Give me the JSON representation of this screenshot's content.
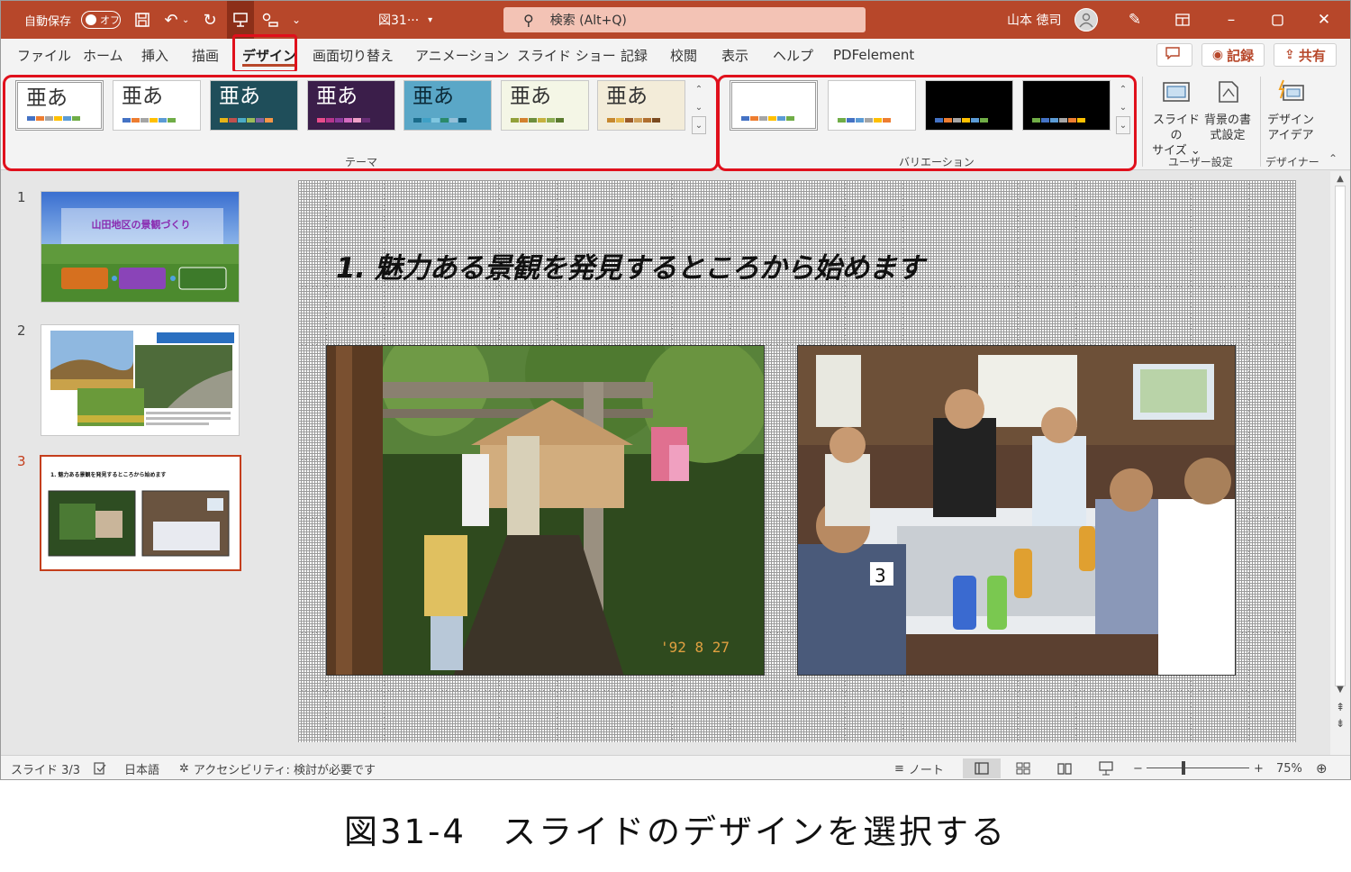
{
  "titlebar": {
    "autosave_label": "自動保存",
    "autosave_state": "オフ",
    "filename": "図31···",
    "filename_caret": "▾",
    "search_placeholder": "検索 (Alt+Q)",
    "username": "山本 徳司",
    "icons": [
      "save-icon",
      "undo-icon",
      "redo-icon",
      "present-icon",
      "touch-mode-icon",
      "customize-icon"
    ],
    "window_icons": [
      "pen-icon",
      "ribbon-display-icon",
      "minimize-icon",
      "maximize-icon",
      "close-icon"
    ]
  },
  "tabs": [
    {
      "label": "ファイル"
    },
    {
      "label": "ホーム"
    },
    {
      "label": "挿入"
    },
    {
      "label": "描画"
    },
    {
      "label": "デザイン",
      "active": true
    },
    {
      "label": "画面切り替え"
    },
    {
      "label": "アニメーション"
    },
    {
      "label": "スライド ショー"
    },
    {
      "label": "記録"
    },
    {
      "label": "校閲"
    },
    {
      "label": "表示"
    },
    {
      "label": "ヘルプ"
    },
    {
      "label": "PDFelement"
    }
  ],
  "ribbon_buttons": {
    "comment": "",
    "record": "記録",
    "share": "共有"
  },
  "themes": {
    "label": "テーマ",
    "glyph": "亜あ",
    "items": [
      {
        "bg": "#ffffff",
        "fg": "#333333",
        "bars": [
          "#4472c4",
          "#ed7d31",
          "#a5a5a5",
          "#ffc000",
          "#5b9bd5",
          "#70ad47"
        ]
      },
      {
        "bg": "#ffffff",
        "fg": "#333333",
        "bars": [
          "#4472c4",
          "#ed7d31",
          "#a5a5a5",
          "#ffc000",
          "#5b9bd5",
          "#70ad47"
        ]
      },
      {
        "bg": "#1f4e5a",
        "fg": "#ffffff",
        "bars": [
          "#e7b416",
          "#c0504d",
          "#4bacc6",
          "#9bbb59",
          "#8064a2",
          "#f79646"
        ]
      },
      {
        "bg": "#3b1e4a",
        "fg": "#ffffff",
        "bars": [
          "#e84c8b",
          "#b5358c",
          "#8b3a9c",
          "#d36bbf",
          "#f0a1c8",
          "#6b2e78"
        ]
      },
      {
        "bg": "#5aa7c7",
        "fg": "#0c2a38",
        "bars": [
          "#1a6b8a",
          "#3ea0c6",
          "#7fc6e0",
          "#2a8a6a",
          "#94c0d8",
          "#0e4f6a"
        ]
      },
      {
        "bg": "#f4f6e6",
        "fg": "#333333",
        "bars": [
          "#92a13a",
          "#d3822f",
          "#6d8f3c",
          "#c6b23f",
          "#8bad52",
          "#5a7a2e"
        ]
      },
      {
        "bg": "#f3ecd9",
        "fg": "#333333",
        "bars": [
          "#c7882f",
          "#e6b54a",
          "#9a5a2a",
          "#d0a05a",
          "#b06f2f",
          "#7a4a20"
        ]
      }
    ]
  },
  "variations": {
    "label": "バリエーション",
    "items": [
      {
        "bg": "#ffffff",
        "bars": [
          "#4472c4",
          "#ed7d31",
          "#a5a5a5",
          "#ffc000",
          "#5b9bd5",
          "#70ad47"
        ]
      },
      {
        "bg": "#ffffff",
        "bars": [
          "#70ad47",
          "#4472c4",
          "#5b9bd5",
          "#a5a5a5",
          "#ffc000",
          "#ed7d31"
        ]
      },
      {
        "bg": "#000000",
        "bars": [
          "#4472c4",
          "#ed7d31",
          "#a5a5a5",
          "#ffc000",
          "#5b9bd5",
          "#70ad47"
        ]
      },
      {
        "bg": "#000000",
        "bars": [
          "#70ad47",
          "#4472c4",
          "#5b9bd5",
          "#a5a5a5",
          "#ed7d31",
          "#ffc000"
        ]
      }
    ]
  },
  "customize_group": {
    "label": "ユーザー設定",
    "slide_size_line1": "スライドの",
    "slide_size_line2": "サイズ ⌄",
    "bg_format_line1": "背景の書",
    "bg_format_line2": "式設定"
  },
  "designer_group": {
    "label": "デザイナー",
    "line1": "デザイン",
    "line2": "アイデア"
  },
  "slides": [
    {
      "num": "1",
      "title": "山田地区の景観づくり"
    },
    {
      "num": "2",
      "title": ""
    },
    {
      "num": "3",
      "title": "1. 魅力ある景観を発見するところから始めます"
    }
  ],
  "current_slide": {
    "title": "1. 魅力ある景観を発見するところから始めます"
  },
  "statusbar": {
    "slide_info": "スライド 3/3",
    "language": "日本語",
    "accessibility": "アクセシビリティ: 検討が必要です",
    "notes": "ノート",
    "zoom_minus": "−",
    "zoom_plus": "+",
    "zoom": "75%"
  },
  "caption": "図31-4　スライドのデザインを選択する"
}
